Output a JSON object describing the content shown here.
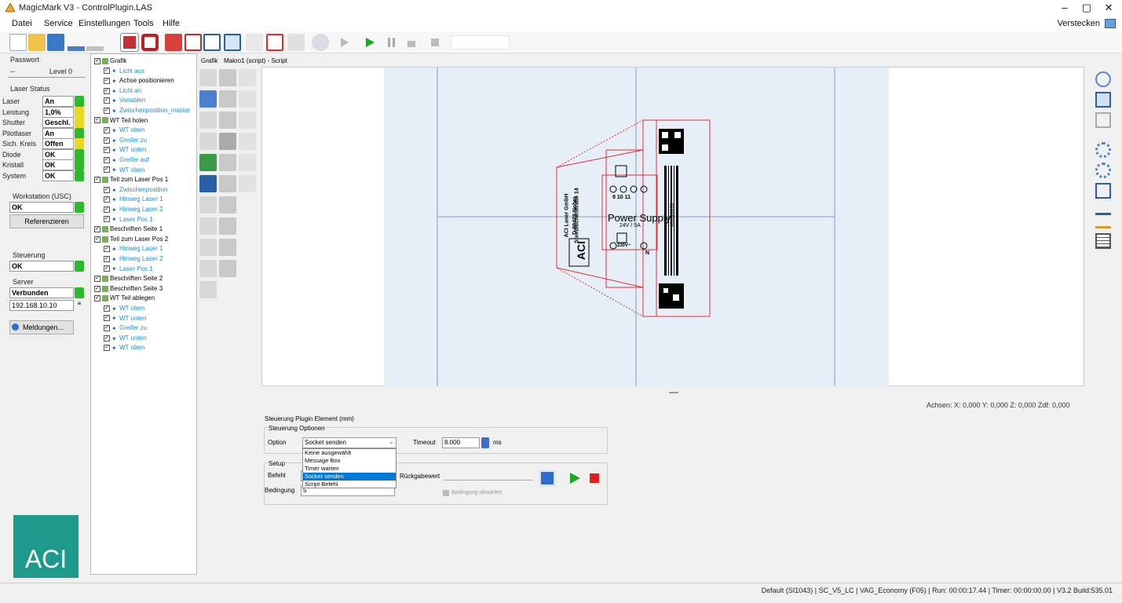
{
  "window": {
    "title": "MagicMark V3 - ControlPlugin.LAS",
    "minimize": "–",
    "maximize": "▢",
    "close": "✕"
  },
  "menu": {
    "items": [
      "Datei",
      "Service",
      "Einstellungen",
      "Tools",
      "Hilfe"
    ],
    "hide_label": "Verstecken"
  },
  "left": {
    "password_label": "Passwort",
    "password_value": "--",
    "level": "Level 0",
    "laser_status_label": "Laser Status",
    "status_rows": [
      {
        "label": "Laser",
        "value": "An",
        "led": "#2db82d"
      },
      {
        "label": "Leistung",
        "value": "1,0%",
        "led": "#e8d820"
      },
      {
        "label": "Shutter",
        "value": "Geschl.",
        "led": "#e8d820"
      },
      {
        "label": "Pilotlaser",
        "value": "An",
        "led": "#2db82d"
      },
      {
        "label": "Sich. Kreis",
        "value": "Offen",
        "led": "#e8d820"
      },
      {
        "label": "Diode",
        "value": "OK",
        "led": "#2db82d"
      },
      {
        "label": "Kristall",
        "value": "OK",
        "led": "#2db82d"
      },
      {
        "label": "System",
        "value": "OK",
        "led": "#2db82d"
      }
    ],
    "workstation_label": "Workstation (USC)",
    "workstation_value": "OK",
    "reference_button": "Referenzieren",
    "control_label": "Steuerung",
    "control_value": "OK",
    "server_label": "Server",
    "server_value": "Verbunden",
    "server_ip": "192.168.10.10",
    "messages_button": "Meldungen...",
    "logo_text": "ACI"
  },
  "tree": {
    "nodes": [
      {
        "text": "Grafik",
        "level": 0,
        "color": "black"
      },
      {
        "text": "Licht aus",
        "level": 1,
        "color": "blue"
      },
      {
        "text": "Achse positionieren",
        "level": 1,
        "color": "black"
      },
      {
        "text": "Licht an",
        "level": 1,
        "color": "blue"
      },
      {
        "text": "Variablen",
        "level": 1,
        "color": "blue"
      },
      {
        "text": "Zwischenposition_master",
        "level": 1,
        "color": "blue"
      },
      {
        "text": "WT Teil holen",
        "level": 0,
        "color": "black"
      },
      {
        "text": "WT oben",
        "level": 1,
        "color": "blue"
      },
      {
        "text": "Greifer zu",
        "level": 1,
        "color": "blue"
      },
      {
        "text": "WT unten",
        "level": 1,
        "color": "blue"
      },
      {
        "text": "Greifer auf",
        "level": 1,
        "color": "blue"
      },
      {
        "text": "WT oben",
        "level": 1,
        "color": "blue"
      },
      {
        "text": "Teil zum Laser Pos 1",
        "level": 0,
        "color": "black"
      },
      {
        "text": "Zwischenposition",
        "level": 1,
        "color": "blue"
      },
      {
        "text": "Hinweg Laser 1",
        "level": 1,
        "color": "blue"
      },
      {
        "text": "Hinweg Laser 2",
        "level": 1,
        "color": "blue"
      },
      {
        "text": "Laser Pos 1",
        "level": 1,
        "color": "blue"
      },
      {
        "text": "Beschriften Seite 1",
        "level": 0,
        "color": "black"
      },
      {
        "text": "Teil zum Laser Pos 2",
        "level": 0,
        "color": "black"
      },
      {
        "text": "Hinweg Laser 1",
        "level": 1,
        "color": "blue"
      },
      {
        "text": "Hinweg Laser 2",
        "level": 1,
        "color": "blue"
      },
      {
        "text": "Laser Pos 1",
        "level": 1,
        "color": "blue"
      },
      {
        "text": "Beschriften Seite 2",
        "level": 0,
        "color": "black"
      },
      {
        "text": "Beschriften Seite 3",
        "level": 0,
        "color": "black"
      },
      {
        "text": "WT Teil ablegen",
        "level": 0,
        "color": "black"
      },
      {
        "text": "WT oben",
        "level": 1,
        "color": "blue"
      },
      {
        "text": "WT unten",
        "level": 1,
        "color": "blue"
      },
      {
        "text": "Greifer zu",
        "level": 1,
        "color": "blue"
      },
      {
        "text": "WT unten",
        "level": 1,
        "color": "blue"
      },
      {
        "text": "WT oben",
        "level": 1,
        "color": "blue"
      }
    ]
  },
  "tabs": [
    "Grafik",
    "Makro1 (script) - Script"
  ],
  "graphic": {
    "company": "ACI Laser GmbH",
    "street": "Steinbüchelstraße 14",
    "city": "D-99428 Nohra",
    "logo": "ACI",
    "product": "Power Supply",
    "spec": "24V / 5A",
    "pins_top": "9 10 11",
    "pins_bottom": "230V~",
    "label_n": "N",
    "serial": "000399953"
  },
  "axes": "Achsen: X: 0,000  Y: 0,000  Z: 0,000  Zdf: 0,000",
  "props": {
    "title": "Steuerung Plugin Element (mm)",
    "options_group": "Steuerung Optionen",
    "option_label": "Option",
    "option_value": "Socket senden",
    "timeout_label": "Timeout",
    "timeout_value": "8.000",
    "timeout_unit": "ms",
    "dropdown_options": [
      "Keine ausgewählt",
      "Message Box",
      "Timer warten",
      "Socket senden",
      "Script Befehl"
    ],
    "selected_option": "Socket senden",
    "setup_group": "Setup",
    "command_label": "Befehl",
    "return_label": "Rückgabewert",
    "condition_label": "Bedingung",
    "condition_value": "5",
    "await_condition": "Bedingung abwarten"
  },
  "status": "Default (SI1043)  |  SC_V5_LC  |  VAG_Economy (F05)  |  Run: 00:00:17.44  |  Timer: 00:00:00.00  |  V3.2 Build:535.01"
}
